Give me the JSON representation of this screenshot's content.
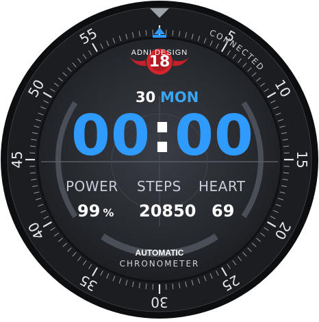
{
  "status": {
    "connected_label": "CONNECTED"
  },
  "brand": {
    "name": "ADNI DESIGN",
    "logo_number": "18"
  },
  "date": {
    "day": "30",
    "weekday": "MON"
  },
  "time": {
    "hours": "00",
    "minutes": "00",
    "separator": ":"
  },
  "stats": [
    {
      "label": "POWER",
      "value": "99",
      "unit": "%"
    },
    {
      "label": "STEPS",
      "value": "20850"
    },
    {
      "label": "HEART",
      "value": "69"
    }
  ],
  "movement": {
    "line1": "AUTOMATIC",
    "line2": "CHRONOMETER"
  },
  "bezel": {
    "numbers": [
      "5",
      "10",
      "15",
      "20",
      "25",
      "30",
      "35",
      "40",
      "45",
      "50",
      "55"
    ]
  },
  "icons": {
    "top_marker": "triangle-marker-icon",
    "charge": "charging-arrow-icon"
  },
  "colors": {
    "accent": "#2f9bff",
    "accent_dark": "#1f6fd6",
    "logo_red": "#c8202a",
    "bezel": "#1a1b1e",
    "dial": "#2a2d33"
  }
}
